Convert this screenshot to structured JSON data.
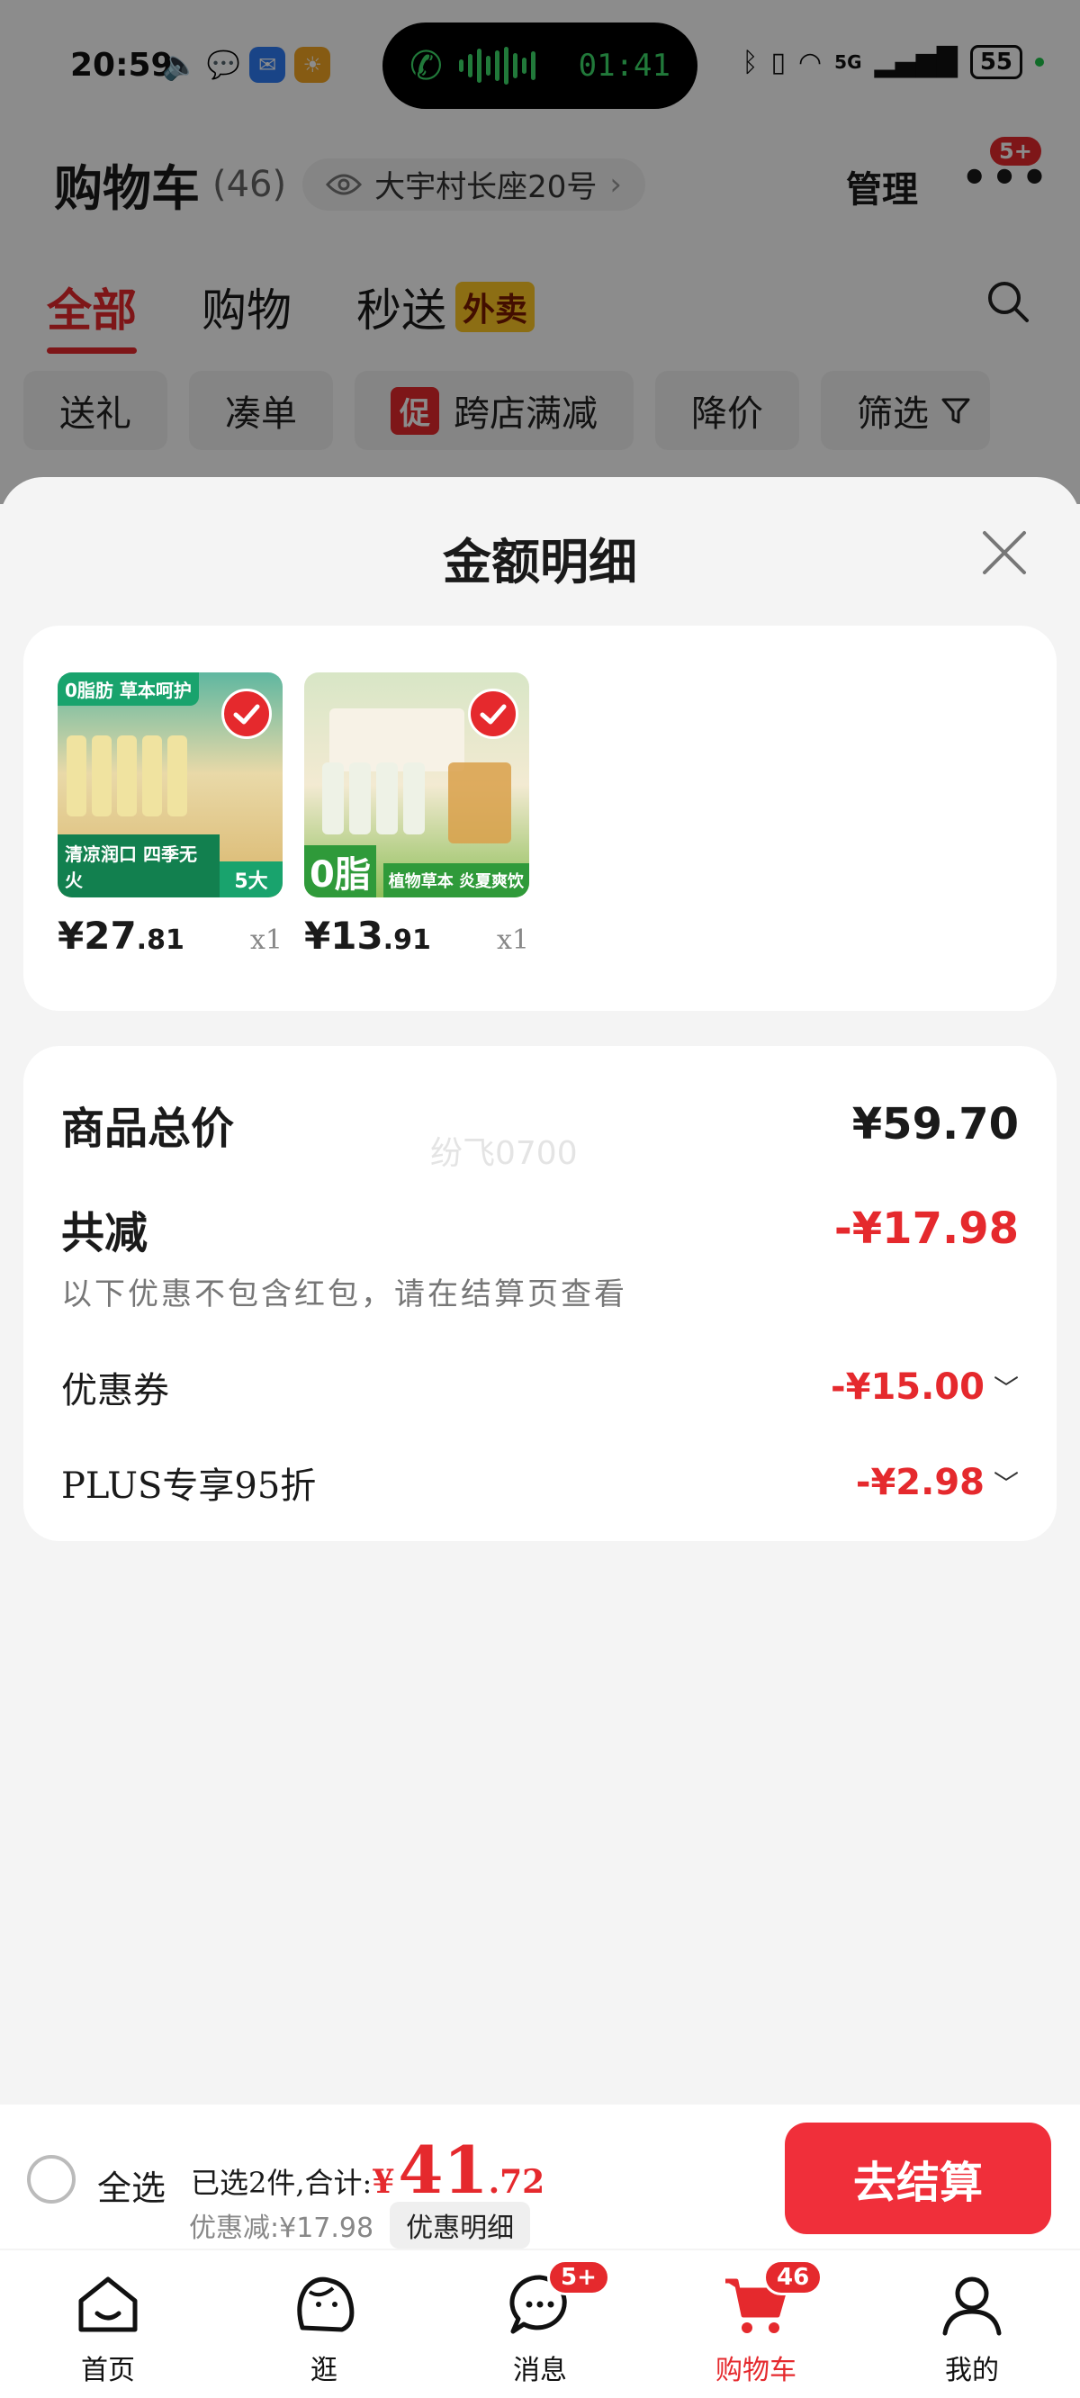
{
  "status_bar": {
    "time": "20:59",
    "call_time": "01:41",
    "battery": "55",
    "network": "5G"
  },
  "header": {
    "title": "购物车",
    "count": "(46)",
    "address": "大宇村长座20号",
    "manage_label": "管理",
    "more_badge": "5+"
  },
  "tabs": [
    {
      "label": "全部",
      "active": true
    },
    {
      "label": "购物",
      "active": false
    },
    {
      "label": "秒送",
      "active": false
    }
  ],
  "tab_waimai_tag": "外卖",
  "filters": {
    "gift": "送礼",
    "bundle": "凑单",
    "promo_tag": "促",
    "cross_store": "跨店满减",
    "price_drop": "降价",
    "filter": "筛选"
  },
  "sheet": {
    "title": "金额明细",
    "products": [
      {
        "price_int": "¥27",
        "price_dec": ".81",
        "qty": "x1"
      },
      {
        "price_int": "¥13",
        "price_dec": ".91",
        "qty": "x1"
      }
    ],
    "product1_banner": "清凉润口 四季无火",
    "product1_tag": "0脂肪 草本呵护",
    "product1_corner": "5大",
    "product2_banner": "0脂",
    "product2_sub": "植物草本 炎夏爽饮",
    "summary": {
      "total_label": "商品总价",
      "total_value": "¥59.70",
      "reduce_label": "共减",
      "reduce_value": "-¥17.98",
      "note": "以下优惠不包含红包，请在结算页查看",
      "coupon_label": "优惠券",
      "coupon_value": "-¥15.00",
      "plus_label": "PLUS专享95折",
      "plus_value": "-¥2.98",
      "watermark": "纷飞0700"
    }
  },
  "checkout": {
    "select_all": "全选",
    "selected_text": "已选2件,合计:",
    "total_yen": "¥",
    "total_int": "41",
    "total_dec": ".72",
    "discount_text": "优惠减:¥17.98",
    "detail_button": "优惠明细",
    "pay_button": "去结算"
  },
  "tabbar": [
    {
      "label": "首页",
      "active": false
    },
    {
      "label": "逛",
      "active": false
    },
    {
      "label": "消息",
      "active": false,
      "badge": "5+"
    },
    {
      "label": "购物车",
      "active": true,
      "badge": "46"
    },
    {
      "label": "我的",
      "active": false
    }
  ],
  "colors": {
    "accent": "#e5292d",
    "pay_button": "#f02f3a",
    "call_green": "#3ddc6a"
  }
}
